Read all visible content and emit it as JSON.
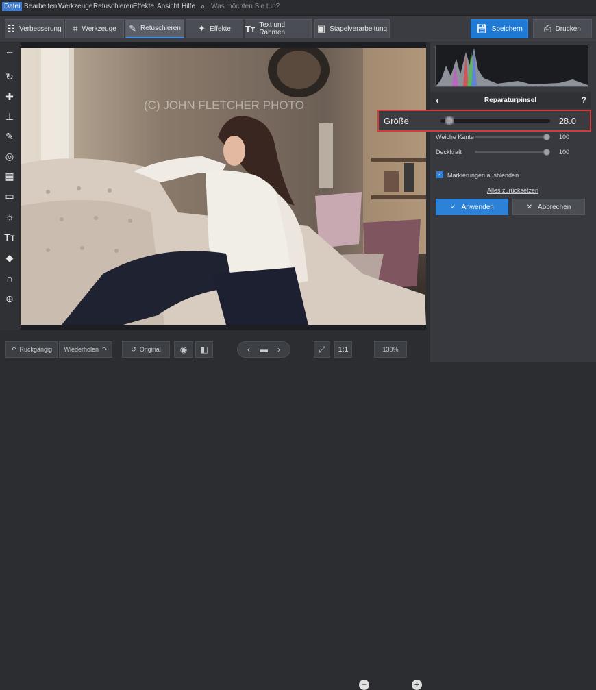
{
  "menu": [
    "Datei",
    "Bearbeiten",
    "Werkzeuge",
    "Retuschieren",
    "Effekte",
    "Ansicht",
    "Hilfe"
  ],
  "search": {
    "placeholder": "Was möchten Sie tun?"
  },
  "toolbar": {
    "tabs": [
      "Verbesserung",
      "Werkzeuge",
      "Retuschieren",
      "Effekte",
      "Text und Rahmen",
      "Stapelverarbeitung"
    ],
    "save_label": "Speichern",
    "print_label": "Drucken"
  },
  "photo": {
    "watermark": "(C) JOHN FLETCHER PHOTO"
  },
  "panel": {
    "title": "Reparaturpinsel",
    "help": "?",
    "size_label": "Größe",
    "size_value": "28.0",
    "size_fraction": 0.08,
    "feather_label": "Weiche Kante",
    "feather_value": "100",
    "opacity_label": "Deckkraft",
    "opacity_value": "100",
    "hide_marks_label": "Markierungen ausblenden",
    "hide_marks_checked": true,
    "reset_label": "Alles zurücksetzen",
    "apply_label": "Anwenden",
    "cancel_label": "Abbrechen"
  },
  "bottom": {
    "undo_label": "Rückgängig",
    "redo_label": "Wiederholen",
    "original_label": "Original",
    "ratio_label": "1:1",
    "zoom_value": "130%"
  }
}
